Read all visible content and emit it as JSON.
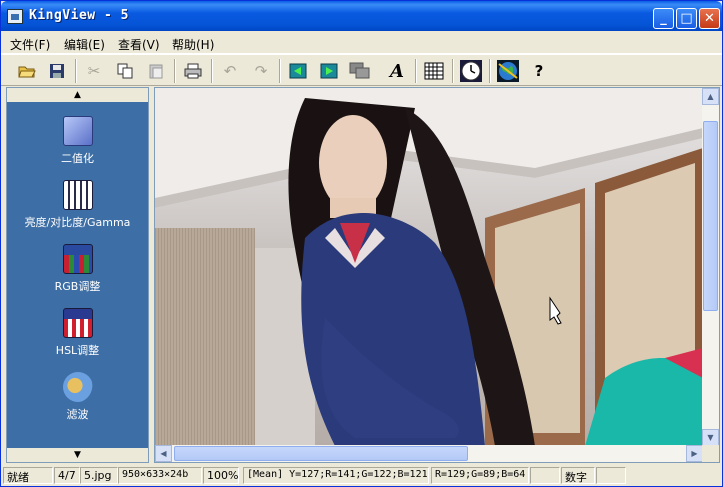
{
  "window": {
    "title": "KingView - 5"
  },
  "title_buttons": {
    "minimize": "_",
    "maximize": "□",
    "close": "✕"
  },
  "menu": [
    {
      "label": "文件(F)"
    },
    {
      "label": "编辑(E)"
    },
    {
      "label": "查看(V)"
    },
    {
      "label": "帮助(H)"
    }
  ],
  "toolbar": {
    "open_icon": "folder-open-icon",
    "save_icon": "save-icon",
    "cut_icon": "cut-icon",
    "copy_icon": "copy-icon",
    "paste_icon": "paste-icon",
    "print_icon": "print-icon",
    "undo_icon": "undo-icon",
    "redo_icon": "redo-icon",
    "prev_icon": "prev-image-icon",
    "next_icon": "next-image-icon",
    "windows_icon": "windows-icon",
    "text_icon": "text-icon",
    "text_glyph": "A",
    "grid_icon": "grid-icon",
    "clock_icon": "clock-icon",
    "globe_icon": "globe-icon",
    "help_icon": "help-icon",
    "help_glyph": "?"
  },
  "tools": [
    {
      "label": "二值化",
      "icon": "binarize-icon",
      "color": "#6a7fd0"
    },
    {
      "label": "亮度/对比度/Gamma",
      "icon": "brightness-icon",
      "color": "#3a4a8a"
    },
    {
      "label": "RGB调整",
      "icon": "rgb-icon",
      "color": "#2a4a9a"
    },
    {
      "label": "HSL调整",
      "icon": "hsl-icon",
      "color": "#a02030"
    },
    {
      "label": "滤波",
      "icon": "filter-icon",
      "color": "#5a8ad0"
    }
  ],
  "status": {
    "ready": "就绪",
    "index": "4/7",
    "filename": "5.jpg",
    "dimensions": "950×633×24b",
    "zoom": "100%",
    "mean": "[Mean] Y=127;R=141;G=122;B=121",
    "pixel": "R=129;G=89;B=64",
    "mode": "数字"
  }
}
